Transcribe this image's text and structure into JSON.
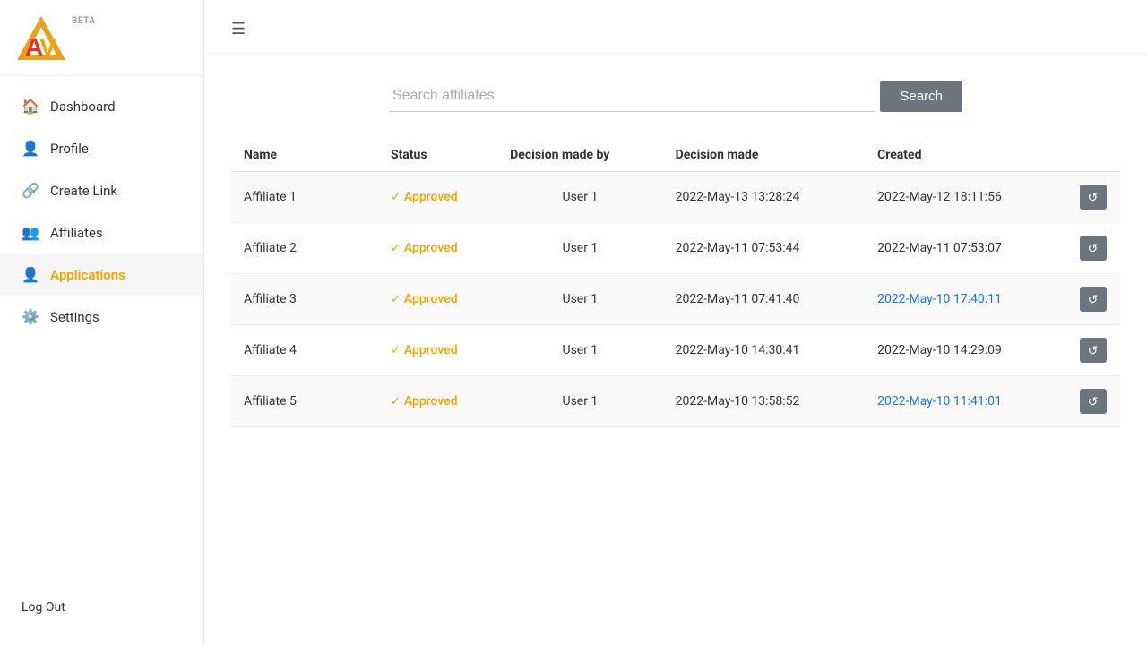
{
  "app": {
    "title": "AV",
    "beta": "BETA"
  },
  "sidebar": {
    "nav_items": [
      {
        "id": "dashboard",
        "label": "Dashboard",
        "icon": "🏠",
        "active": false
      },
      {
        "id": "profile",
        "label": "Profile",
        "icon": "👤",
        "active": false
      },
      {
        "id": "create-link",
        "label": "Create Link",
        "icon": "🔗",
        "active": false
      },
      {
        "id": "affiliates",
        "label": "Affiliates",
        "icon": "👥",
        "active": false
      },
      {
        "id": "applications",
        "label": "Applications",
        "icon": "👤",
        "active": true
      },
      {
        "id": "settings",
        "label": "Settings",
        "icon": "⚙️",
        "active": false
      }
    ],
    "logout_label": "Log Out"
  },
  "search": {
    "placeholder": "Search affiliates",
    "button_label": "Search"
  },
  "table": {
    "columns": [
      "Name",
      "Status",
      "Decision made by",
      "Decision made",
      "Created"
    ],
    "rows": [
      {
        "name": "Affiliate 1",
        "status": "Approved",
        "decision_by": "User 1",
        "decision_made": "2022-May-13 13:28:24",
        "created": "2022-May-12 18:11:56",
        "created_highlight": false
      },
      {
        "name": "Affiliate 2",
        "status": "Approved",
        "decision_by": "User 1",
        "decision_made": "2022-May-11 07:53:44",
        "created": "2022-May-11 07:53:07",
        "created_highlight": false
      },
      {
        "name": "Affiliate 3",
        "status": "Approved",
        "decision_by": "User 1",
        "decision_made": "2022-May-11 07:41:40",
        "created": "2022-May-10 17:40:11",
        "created_highlight": true
      },
      {
        "name": "Affiliate 4",
        "status": "Approved",
        "decision_by": "User 1",
        "decision_made": "2022-May-10 14:30:41",
        "created": "2022-May-10 14:29:09",
        "created_highlight": false
      },
      {
        "name": "Affiliate 5",
        "status": "Approved",
        "decision_by": "User 1",
        "decision_made": "2022-May-10 13:58:52",
        "created": "2022-May-10 11:41:01",
        "created_highlight": true
      }
    ]
  },
  "colors": {
    "accent": "#f0a500",
    "active_nav_bg": "#f5f5f5",
    "button_bg": "#6c757d",
    "highlight_date": "#1a73e8"
  }
}
